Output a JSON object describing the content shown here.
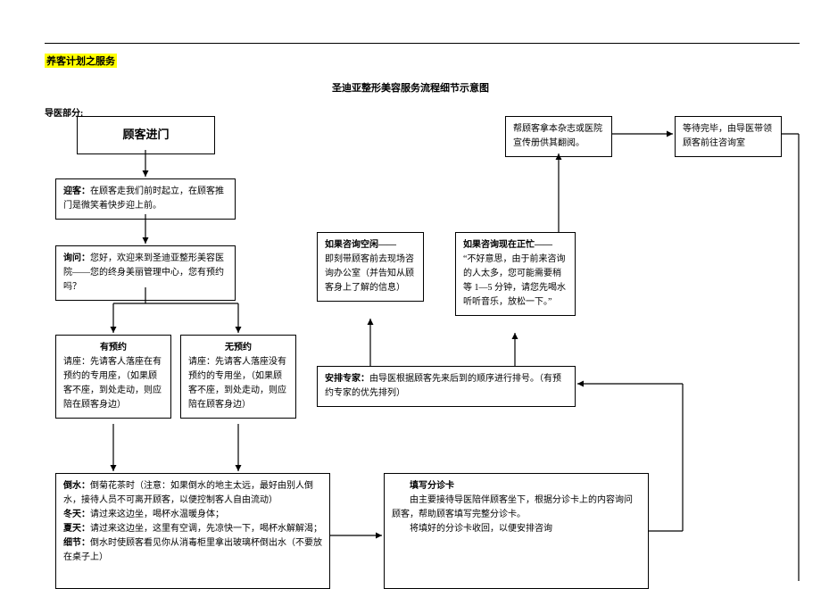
{
  "sectionTitle": "养客计划之服务",
  "diagramTitle": "圣迪亚整形美容服务流程细节示意图",
  "subsection": "导医部分:",
  "entry": "顾客进门",
  "welcome": {
    "label": "迎客：",
    "text": "在顾客走我们前时起立，在顾客推门是微笑着快步迎上前。"
  },
  "inquiry": {
    "label": "询问：",
    "text": "您好，欢迎来到圣迪亚整形美容医院——您的终身美丽管理中心，您有预约吗？"
  },
  "hasAppt": {
    "title": "有预约",
    "text": "请座：先请客人落座在有预约的专用座，（如果顾客不座，到处走动，则应陪在顾客身边）"
  },
  "noAppt": {
    "title": "无预约",
    "text": "请座：先请客人落座没有预约的专用坐，（如果顾客不座，到处走动，则应陪在顾客身边）"
  },
  "water": {
    "label1": "倒水：",
    "text1": "倒菊花茶时（注意：如果倒水的地主太远，最好由别人倒水，接待人员不可离开顾客，以便控制客人自由流动）",
    "label2": "冬天：",
    "text2": "请过来这边坐，喝杯水温暖身体；",
    "label3": "夏天：",
    "text3": "请过来这边坐，这里有空调，先凉快一下，喝杯水解解渴；",
    "label4": "细节：",
    "text4": "倒水时使顾客看见你从消毒柜里拿出玻璃杯倒出水（不要放在桌子上）"
  },
  "consultFree": {
    "title": "如果咨询空闲——",
    "text": "即刻带顾客前去现场咨询办公室（并告知从顾客身上了解的信息）"
  },
  "consultBusy": {
    "title": "如果咨询现在正忙——",
    "text": "“不好意思，由于前来咨询的人太多，您可能需要稍等 1—5 分钟，请您先喝水听听音乐，放松一下。”"
  },
  "expert": {
    "label": "安排专家：",
    "text": "由导医根据顾客先来后到的顺序进行排号。（有预约专家的优先排列）"
  },
  "card": {
    "title": "填写分诊卡",
    "line1": "由主要接待导医陪伴顾客坐下，根据分诊卡上的内容询问顾客，帮助顾客填写完整分诊卡。",
    "line2": "将填好的分诊卡收回，以便安排咨询"
  },
  "magazine": "帮顾客拿本杂志或医院宣传册供其翻阅。",
  "waitDone": "等待完毕，由导医带领顾客前往咨询室"
}
